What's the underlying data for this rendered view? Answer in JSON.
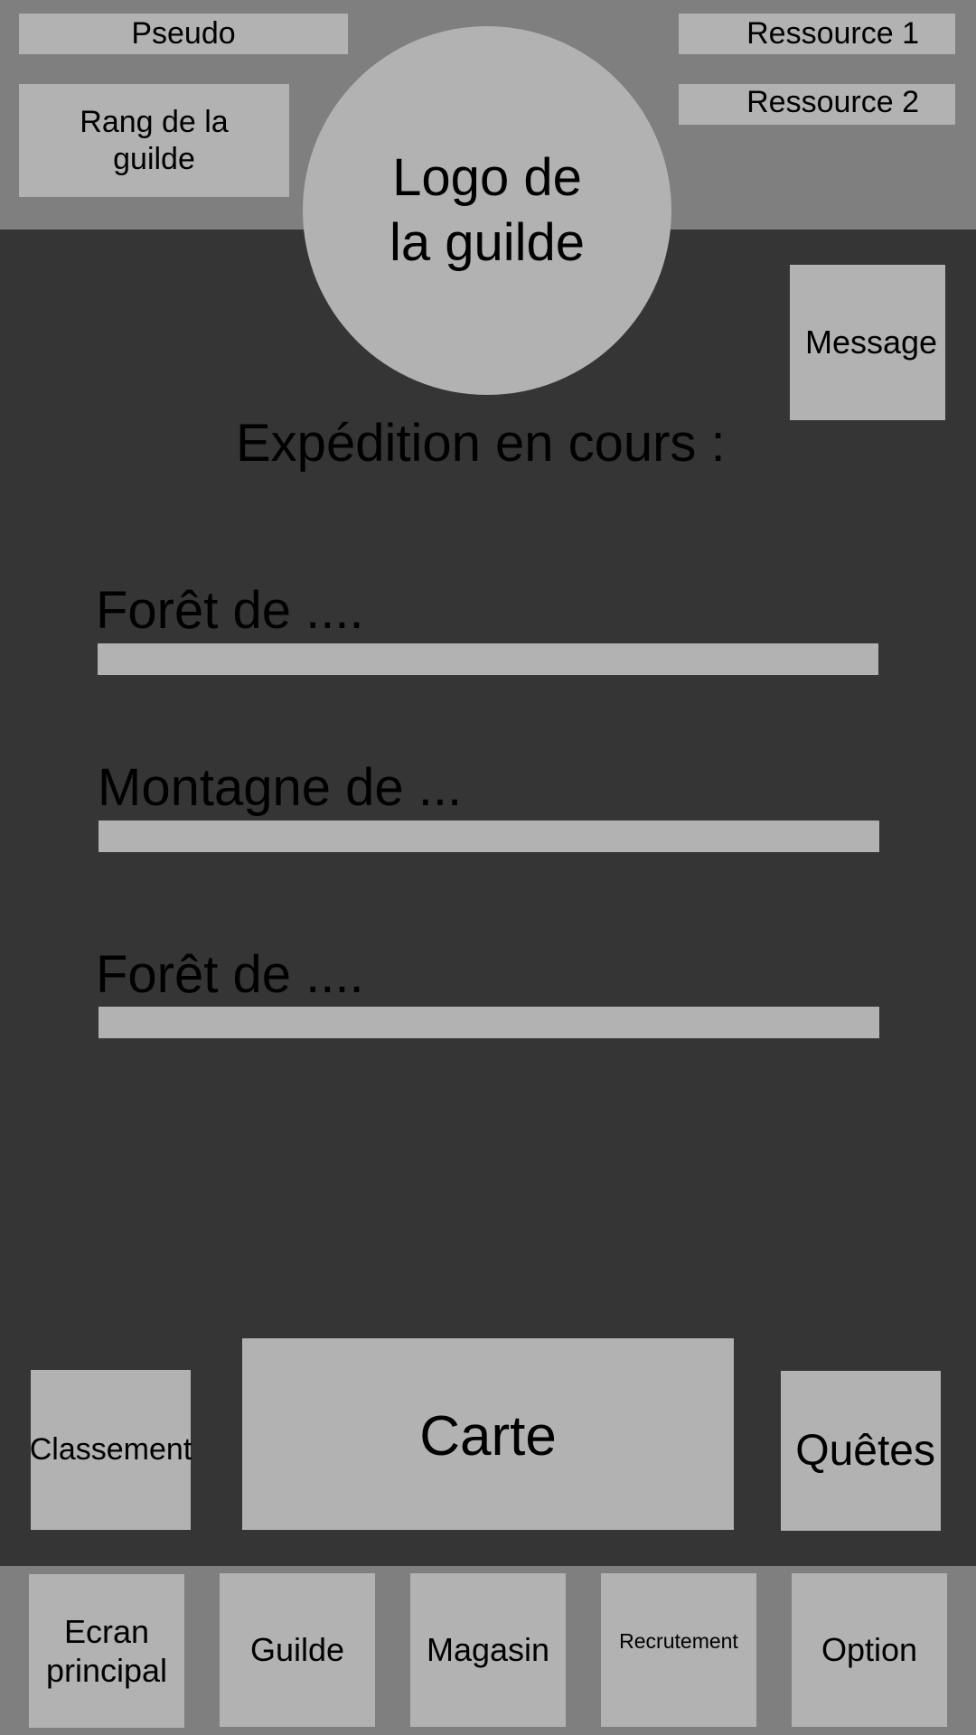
{
  "header": {
    "pseudo": "Pseudo",
    "guild_rank": "Rang de la guilde",
    "logo": "Logo de la guilde",
    "resource_1": "Ressource 1",
    "resource_2": "Ressource 2"
  },
  "message_button": "Message",
  "expeditions": {
    "title": "Expédition en cours :",
    "items": [
      {
        "name": "Forêt de ...."
      },
      {
        "name": "Montagne de ..."
      },
      {
        "name": "Forêt de ...."
      }
    ]
  },
  "actions": {
    "ranking": "Classement",
    "map": "Carte",
    "quests": "Quêtes"
  },
  "bottom_nav": [
    {
      "label": "Ecran principal"
    },
    {
      "label": "Guilde"
    },
    {
      "label": "Magasin"
    },
    {
      "label": "Recrutement"
    },
    {
      "label": "Option"
    }
  ],
  "colors": {
    "header_bg": "#7f7f7f",
    "main_bg": "#353535",
    "element_bg": "#b2b2b2"
  }
}
